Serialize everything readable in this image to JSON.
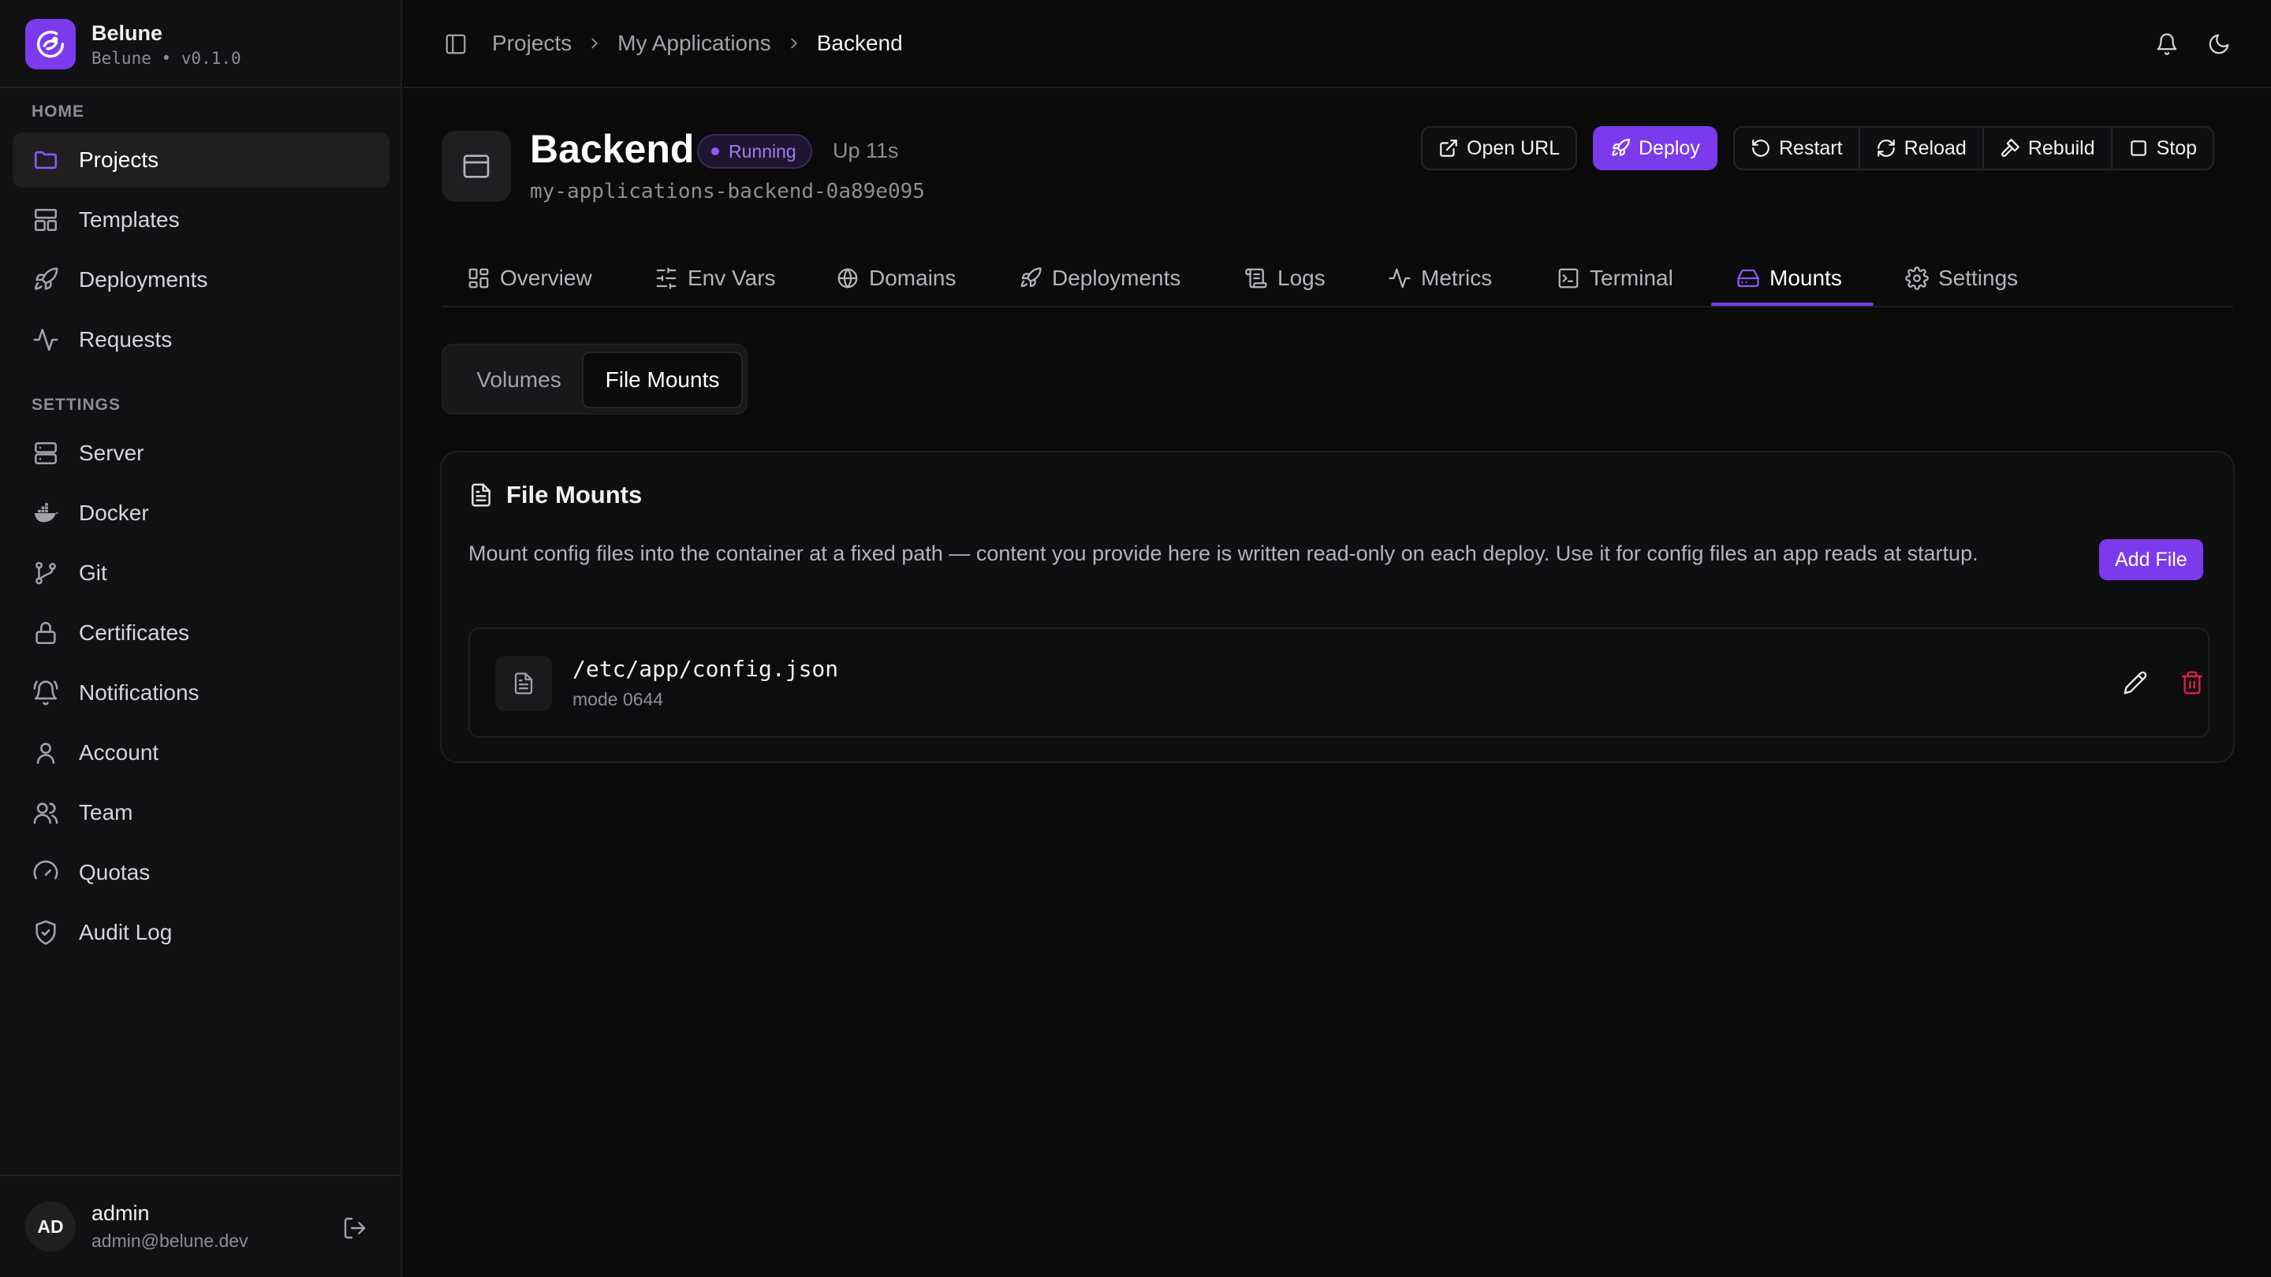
{
  "brand": {
    "name": "Belune",
    "version": "Belune • v0.1.0"
  },
  "sidebar": {
    "home_label": "HOME",
    "home_items": [
      {
        "label": "Projects",
        "icon": "folder-icon",
        "active": true
      },
      {
        "label": "Templates",
        "icon": "layout-icon"
      },
      {
        "label": "Deployments",
        "icon": "rocket-icon"
      },
      {
        "label": "Requests",
        "icon": "activity-icon"
      }
    ],
    "settings_label": "SETTINGS",
    "settings_items": [
      {
        "label": "Server",
        "icon": "server-icon"
      },
      {
        "label": "Docker",
        "icon": "docker-icon"
      },
      {
        "label": "Git",
        "icon": "git-branch-icon"
      },
      {
        "label": "Certificates",
        "icon": "lock-icon"
      },
      {
        "label": "Notifications",
        "icon": "bell-ring-icon"
      },
      {
        "label": "Account",
        "icon": "user-icon"
      },
      {
        "label": "Team",
        "icon": "users-icon"
      },
      {
        "label": "Quotas",
        "icon": "gauge-icon"
      },
      {
        "label": "Audit Log",
        "icon": "shield-check-icon"
      }
    ]
  },
  "user": {
    "initials": "AD",
    "name": "admin",
    "email": "admin@belune.dev"
  },
  "breadcrumb": [
    "Projects",
    "My Applications",
    "Backend"
  ],
  "app": {
    "title": "Backend",
    "status": "Running",
    "uptime": "Up 11s",
    "slug": "my-applications-backend-0a89e095"
  },
  "actions": {
    "open_url": "Open URL",
    "deploy": "Deploy",
    "restart": "Restart",
    "reload": "Reload",
    "rebuild": "Rebuild",
    "stop": "Stop"
  },
  "tabs": [
    {
      "label": "Overview",
      "icon": "grid-icon"
    },
    {
      "label": "Env Vars",
      "icon": "sliders-icon"
    },
    {
      "label": "Domains",
      "icon": "globe-icon"
    },
    {
      "label": "Deployments",
      "icon": "rocket-icon"
    },
    {
      "label": "Logs",
      "icon": "scroll-icon"
    },
    {
      "label": "Metrics",
      "icon": "activity-icon"
    },
    {
      "label": "Terminal",
      "icon": "terminal-icon"
    },
    {
      "label": "Mounts",
      "icon": "hard-drive-icon",
      "active": true
    },
    {
      "label": "Settings",
      "icon": "gear-icon"
    }
  ],
  "segmented": {
    "volumes": "Volumes",
    "file_mounts": "File Mounts",
    "active": "File Mounts"
  },
  "card": {
    "title": "File Mounts",
    "description": "Mount config files into the container at a fixed path — content you provide here is written read-only on each deploy. Use it for config files an app reads at startup.",
    "add_button": "Add File",
    "files": [
      {
        "path": "/etc/app/config.json",
        "mode": "mode 0644"
      }
    ]
  },
  "colors": {
    "accent": "#7c3aed",
    "danger": "#e11d48",
    "background": "#0b0b0c"
  }
}
